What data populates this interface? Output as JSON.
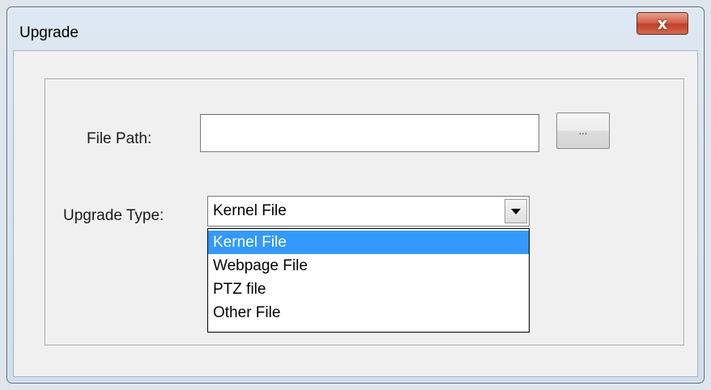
{
  "window": {
    "title": "Upgrade",
    "close_glyph": "x"
  },
  "form": {
    "file_path_label": "File Path:",
    "file_path_value": "",
    "browse_label": "...",
    "upgrade_type_label": "Upgrade Type:",
    "upgrade_type_selected": "Kernel File",
    "upgrade_type_options": [
      {
        "label": "Kernel File",
        "selected": true
      },
      {
        "label": "Webpage File",
        "selected": false
      },
      {
        "label": "PTZ file",
        "selected": false
      },
      {
        "label": "Other File",
        "selected": false
      }
    ]
  },
  "colors": {
    "selection_highlight": "#3399ff",
    "close_button": "#c2402a"
  },
  "icons": {
    "close": "close-icon",
    "dropdown": "chevron-down-icon"
  }
}
